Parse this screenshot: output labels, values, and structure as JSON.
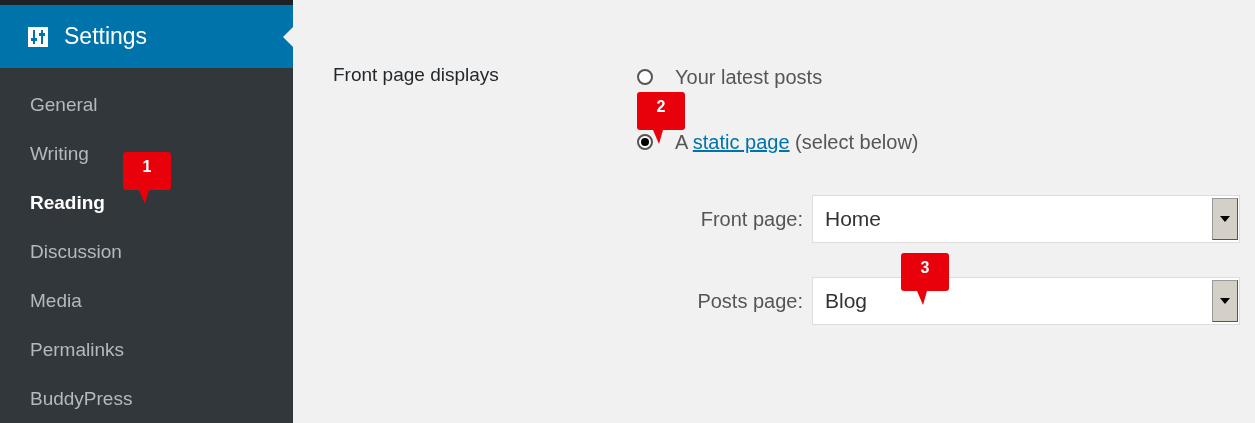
{
  "sidebar": {
    "title": "Settings",
    "items": [
      {
        "label": "General",
        "selected": false
      },
      {
        "label": "Writing",
        "selected": false
      },
      {
        "label": "Reading",
        "selected": true
      },
      {
        "label": "Discussion",
        "selected": false
      },
      {
        "label": "Media",
        "selected": false
      },
      {
        "label": "Permalinks",
        "selected": false
      },
      {
        "label": "BuddyPress",
        "selected": false
      }
    ]
  },
  "front_page_displays": {
    "label": "Front page displays",
    "options": [
      {
        "kind": "plain",
        "label": "Your latest posts",
        "selected": false
      },
      {
        "kind": "link",
        "before": "A",
        "link": "static page",
        "after": "(select below)",
        "selected": true
      }
    ],
    "selects": [
      {
        "label": "Front page:",
        "value": "Home"
      },
      {
        "label": "Posts page:",
        "value": "Blog"
      }
    ]
  },
  "callouts": [
    {
      "label": "1"
    },
    {
      "label": "2"
    },
    {
      "label": "3"
    }
  ]
}
